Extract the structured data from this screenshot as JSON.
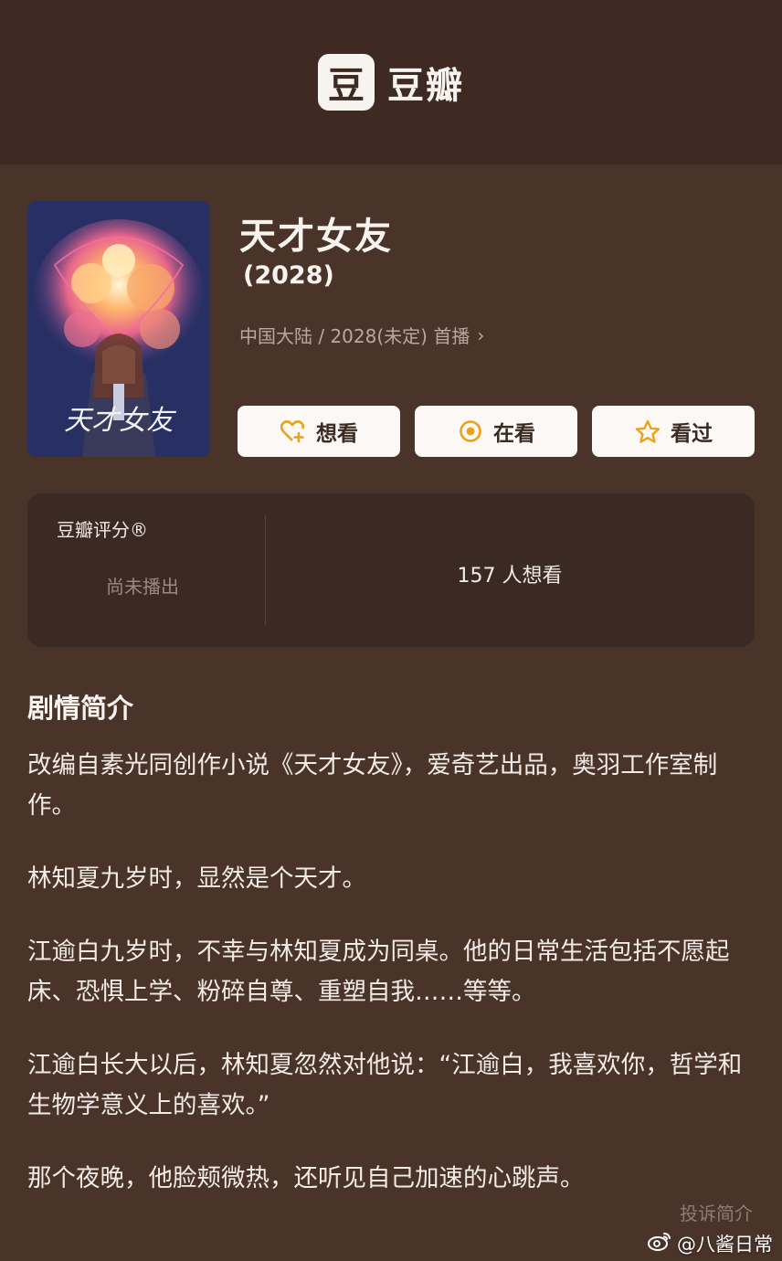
{
  "header": {
    "logo_glyph": "豆",
    "logo_text": "豆瓣"
  },
  "poster": {
    "art_text": "天才女友",
    "alt": "poster image"
  },
  "movie": {
    "title": "天才女友",
    "year": "(2028)",
    "meta": "中国大陆 / 2028(未定) 首播",
    "chevron": "›"
  },
  "actions": [
    {
      "label": "想看",
      "icon": "heart-plus-icon"
    },
    {
      "label": "在看",
      "icon": "target-circle-icon"
    },
    {
      "label": "看过",
      "icon": "star-icon"
    }
  ],
  "rating": {
    "label": "豆瓣评分®",
    "status": "尚未播出",
    "want_count": "157 人想看"
  },
  "synopsis": {
    "title": "剧情简介",
    "paragraphs": [
      "改编自素光同创作小说《天才女友》，爱奇艺出品，奥羽工作室制作。",
      "林知夏九岁时，显然是个天才。",
      "江逾白九岁时，不幸与林知夏成为同桌。他的日常生活包括不愿起床、恐惧上学、粉碎自尊、重塑自我……等等。",
      "江逾白长大以后，林知夏忽然对他说：“江逾白，我喜欢你，哲学和生物学意义上的喜欢。”",
      "那个夜晚，他脸颊微热，还听见自己加速的心跳声。"
    ],
    "report_link": "投诉简介"
  },
  "watermark": {
    "text": "@八酱日常"
  },
  "colors": {
    "background": "#4a3329",
    "topbar": "#3e2a22",
    "card": "#3b2923",
    "accent": "#e8a317"
  }
}
